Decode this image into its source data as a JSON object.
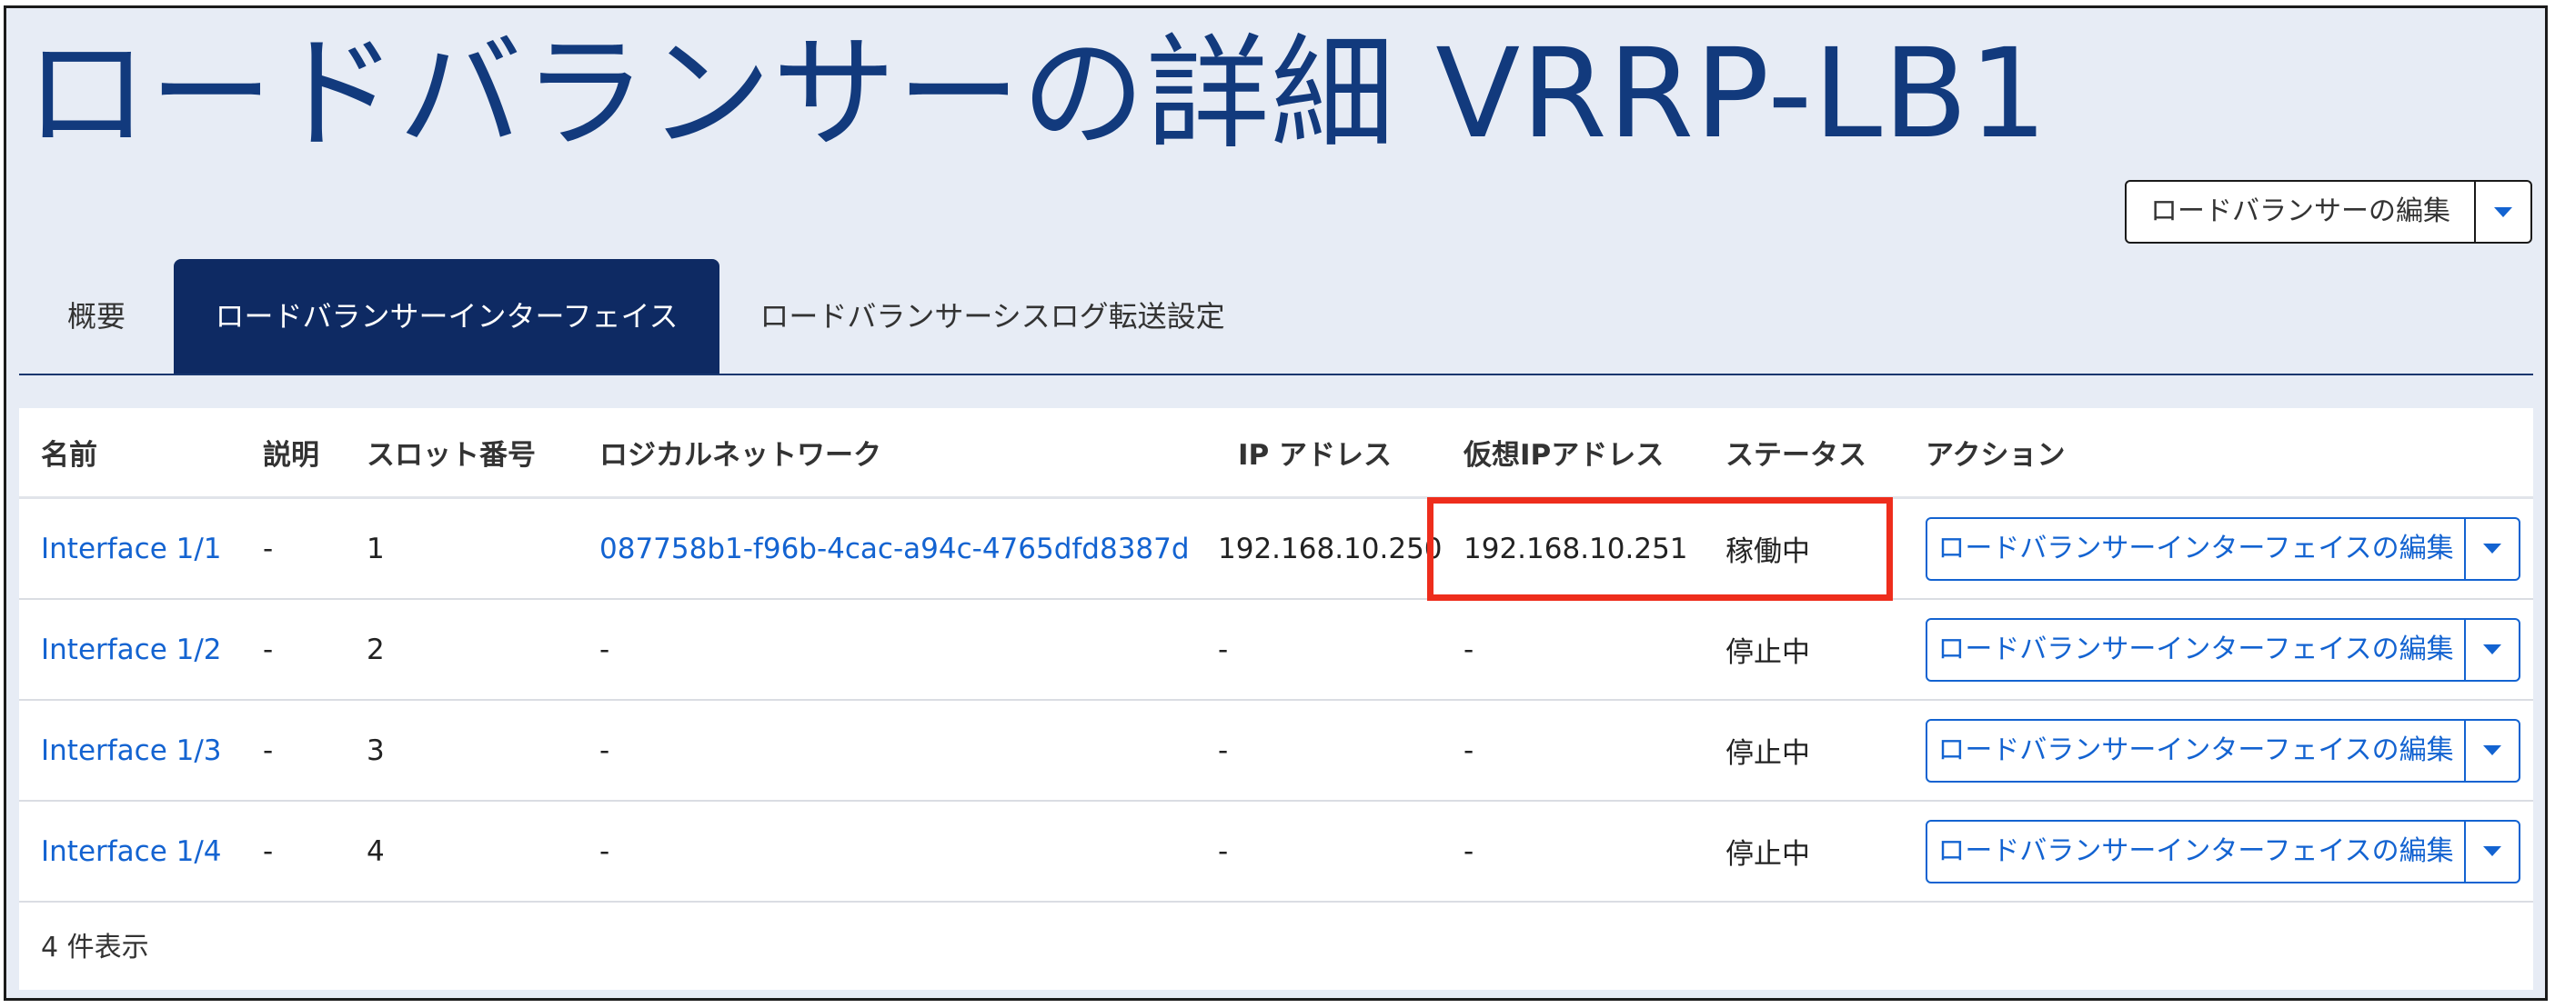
{
  "page": {
    "title": "ロードバランサーの詳細 VRRP-LB1",
    "edit_button_label": "ロードバランサーの編集"
  },
  "tabs": [
    {
      "label": "概要",
      "active": false
    },
    {
      "label": "ロードバランサーインターフェイス",
      "active": true
    },
    {
      "label": "ロードバランサーシスログ転送設定",
      "active": false
    }
  ],
  "table": {
    "headers": [
      "名前",
      "説明",
      "スロット番号",
      "ロジカルネットワーク",
      "IP アドレス",
      "仮想IPアドレス",
      "ステータス",
      "アクション"
    ],
    "rows": [
      {
        "name": "Interface 1/1",
        "description": "-",
        "slot": "1",
        "logical_network": "087758b1-f96b-4cac-a94c-4765dfd8387d",
        "ip": "192.168.10.250",
        "virtual_ip": "192.168.10.251",
        "status": "稼働中",
        "action_label": "ロードバランサーインターフェイスの編集"
      },
      {
        "name": "Interface 1/2",
        "description": "-",
        "slot": "2",
        "logical_network": "-",
        "ip": "-",
        "virtual_ip": "-",
        "status": "停止中",
        "action_label": "ロードバランサーインターフェイスの編集"
      },
      {
        "name": "Interface 1/3",
        "description": "-",
        "slot": "3",
        "logical_network": "-",
        "ip": "-",
        "virtual_ip": "-",
        "status": "停止中",
        "action_label": "ロードバランサーインターフェイスの編集"
      },
      {
        "name": "Interface 1/4",
        "description": "-",
        "slot": "4",
        "logical_network": "-",
        "ip": "-",
        "virtual_ip": "-",
        "status": "停止中",
        "action_label": "ロードバランサーインターフェイスの編集"
      }
    ],
    "footer": "4 件表示"
  },
  "colors": {
    "title": "#123a7d",
    "active_tab": "#0e2a63",
    "link": "#1363d1",
    "highlight": "#ee2d1c",
    "background": "#e7ecf5"
  },
  "icons": {
    "dropdown": "chevron-down-icon"
  }
}
